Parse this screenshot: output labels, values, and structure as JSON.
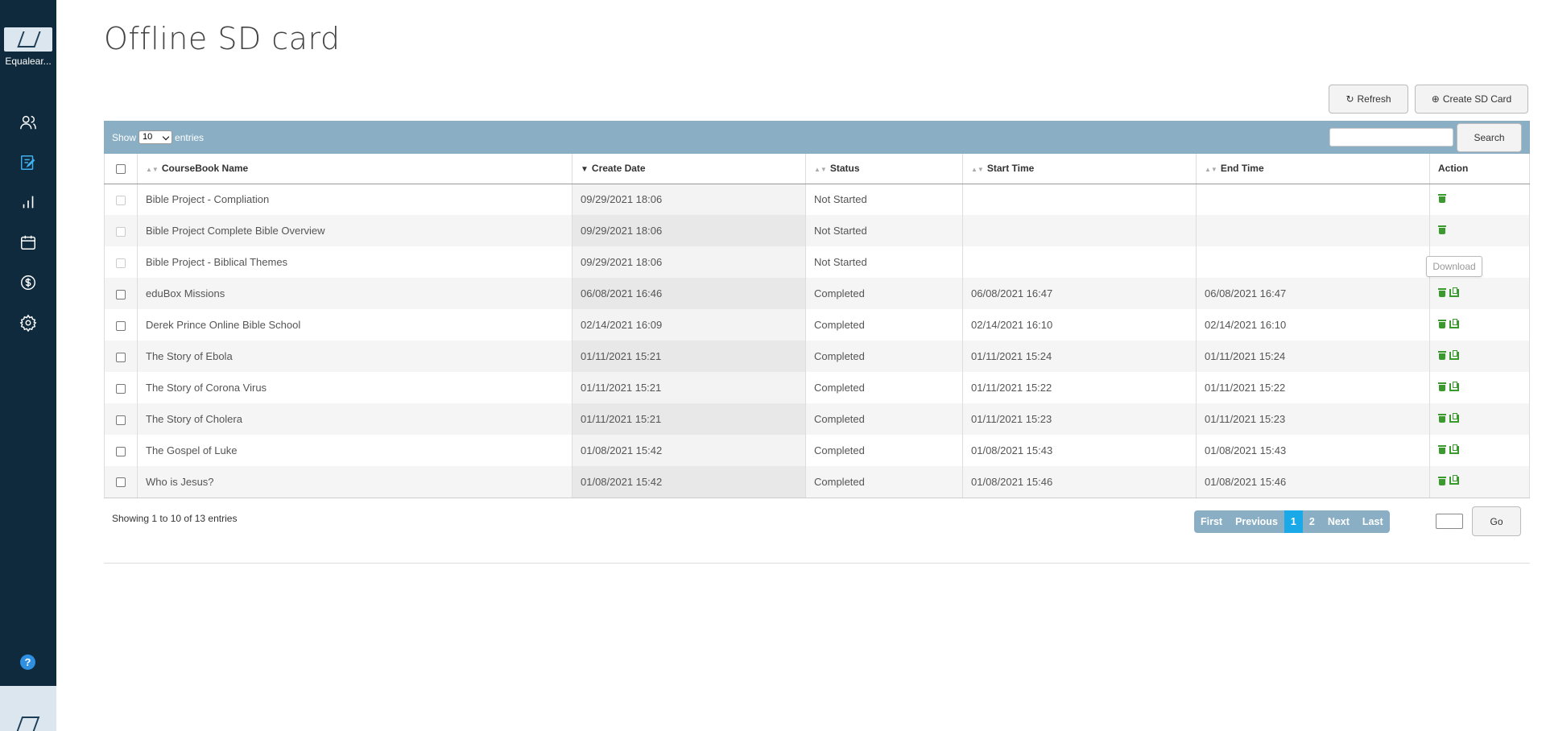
{
  "sidebar": {
    "org_name": "Equalear...",
    "nav": [
      {
        "icon": "users-icon"
      },
      {
        "icon": "edit-icon"
      },
      {
        "icon": "bar-chart-icon"
      },
      {
        "icon": "calendar-icon"
      },
      {
        "icon": "dollar-icon"
      },
      {
        "icon": "gear-icon"
      }
    ],
    "help": "?"
  },
  "page": {
    "title": "Offline SD card",
    "refresh_label": "Refresh",
    "create_label": "Create SD Card"
  },
  "toolbar": {
    "show_label": "Show",
    "entries_value": "10",
    "entries_label": "entries",
    "search_label": "Search"
  },
  "table": {
    "headers": [
      "CourseBook Name",
      "Create Date",
      "Status",
      "Start Time",
      "End Time",
      "Action"
    ],
    "rows": [
      {
        "name": "Bible Project - Compliation",
        "create": "09/29/2021 18:06",
        "status": "Not Started",
        "start": "",
        "end": "",
        "download": false
      },
      {
        "name": "Bible Project Complete Bible Overview",
        "create": "09/29/2021 18:06",
        "status": "Not Started",
        "start": "",
        "end": "",
        "download": false
      },
      {
        "name": "Bible Project - Biblical Themes",
        "create": "09/29/2021 18:06",
        "status": "Not Started",
        "start": "",
        "end": "",
        "download": false
      },
      {
        "name": "eduBox Missions",
        "create": "06/08/2021 16:46",
        "status": "Completed",
        "start": "06/08/2021 16:47",
        "end": "06/08/2021 16:47",
        "download": true
      },
      {
        "name": "Derek Prince Online Bible School",
        "create": "02/14/2021 16:09",
        "status": "Completed",
        "start": "02/14/2021 16:10",
        "end": "02/14/2021 16:10",
        "download": true
      },
      {
        "name": "The Story of Ebola",
        "create": "01/11/2021 15:21",
        "status": "Completed",
        "start": "01/11/2021 15:24",
        "end": "01/11/2021 15:24",
        "download": true
      },
      {
        "name": "The Story of Corona Virus",
        "create": "01/11/2021 15:21",
        "status": "Completed",
        "start": "01/11/2021 15:22",
        "end": "01/11/2021 15:22",
        "download": true
      },
      {
        "name": "The Story of Cholera",
        "create": "01/11/2021 15:21",
        "status": "Completed",
        "start": "01/11/2021 15:23",
        "end": "01/11/2021 15:23",
        "download": true
      },
      {
        "name": "The Gospel of Luke",
        "create": "01/08/2021 15:42",
        "status": "Completed",
        "start": "01/08/2021 15:43",
        "end": "01/08/2021 15:43",
        "download": true
      },
      {
        "name": "Who is Jesus?",
        "create": "01/08/2021 15:42",
        "status": "Completed",
        "start": "01/08/2021 15:46",
        "end": "01/08/2021 15:46",
        "download": true
      }
    ]
  },
  "tooltip": "Download",
  "footer": {
    "info": "Showing 1 to 10 of 13 entries",
    "pager": [
      "First",
      "Previous",
      "1",
      "2",
      "Next",
      "Last"
    ],
    "active_page": "1",
    "go_label": "Go"
  },
  "colors": {
    "sidebar_bg": "#0f2a3c",
    "toolbar_bg": "#8aafc4",
    "active_page": "#19a8e8",
    "action_icon": "#3a9a2e"
  }
}
